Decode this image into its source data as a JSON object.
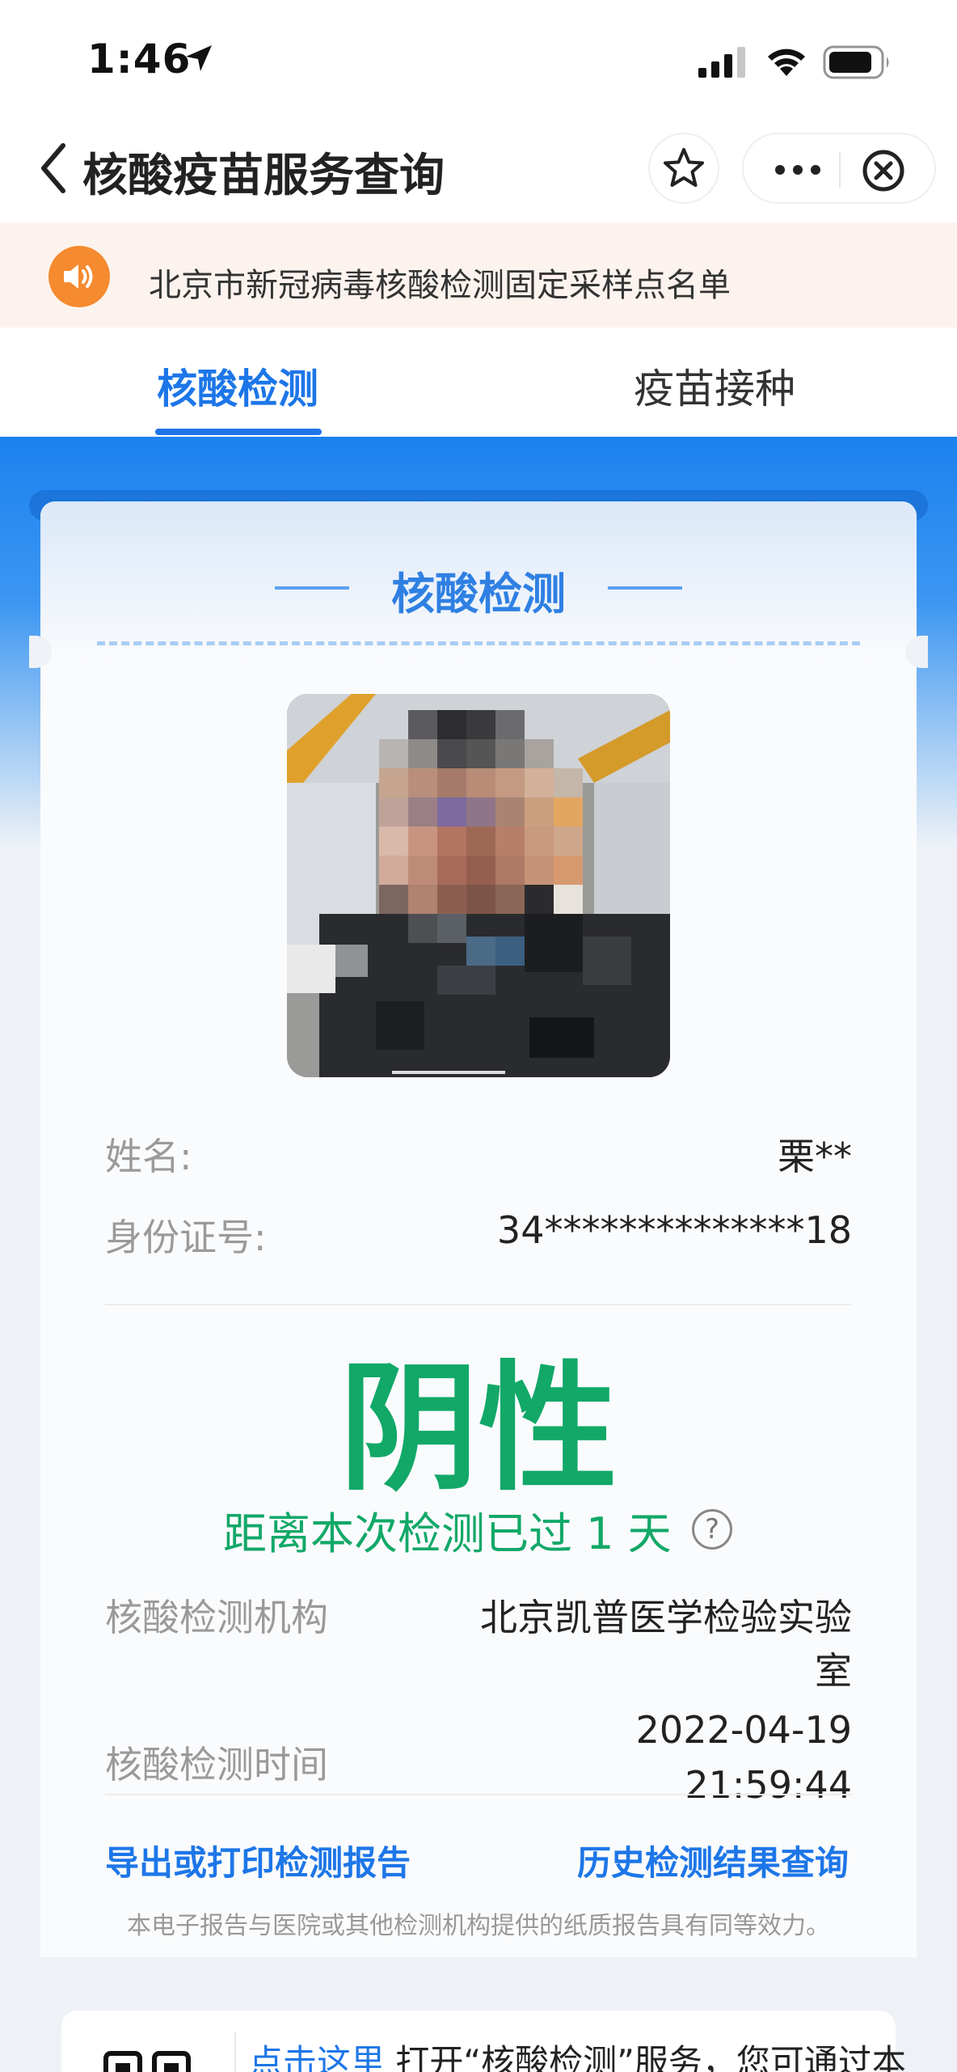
{
  "status_bar": {
    "time": "1:46"
  },
  "nav": {
    "title": "核酸疫苗服务查询"
  },
  "notice": {
    "text": "北京市新冠病毒核酸检测固定采样点名单"
  },
  "tabs": [
    {
      "label": "核酸检测",
      "active": true
    },
    {
      "label": "疫苗接种",
      "active": false
    }
  ],
  "card": {
    "title": "核酸检测",
    "name_label": "姓名:",
    "name_value": "栗**",
    "id_label": "身份证号:",
    "id_value": "34**************18",
    "result": "阴性",
    "days_text": "距离本次检测已过 1 天",
    "institution_label": "核酸检测机构",
    "institution_value_line1": "北京凯普医学检验实验",
    "institution_value_line2": "室",
    "time_label": "核酸检测时间",
    "time_value_date": "2022-04-19",
    "time_value_clock": "21:59:44",
    "export_link": "导出或打印检测报告",
    "history_link": "历史检测结果查询",
    "footnote": "本电子报告与医院或其他检测机构提供的纸质报告具有同等效力。"
  },
  "bottom": {
    "link_text": "点击这里",
    "text": " 打开“核酸检测”服务，您可通过本"
  },
  "colors": {
    "accent_blue": "#1d76e8",
    "result_green": "#12a868",
    "notice_bg": "#fdf3ee",
    "speaker_orange": "#f58a2f"
  }
}
